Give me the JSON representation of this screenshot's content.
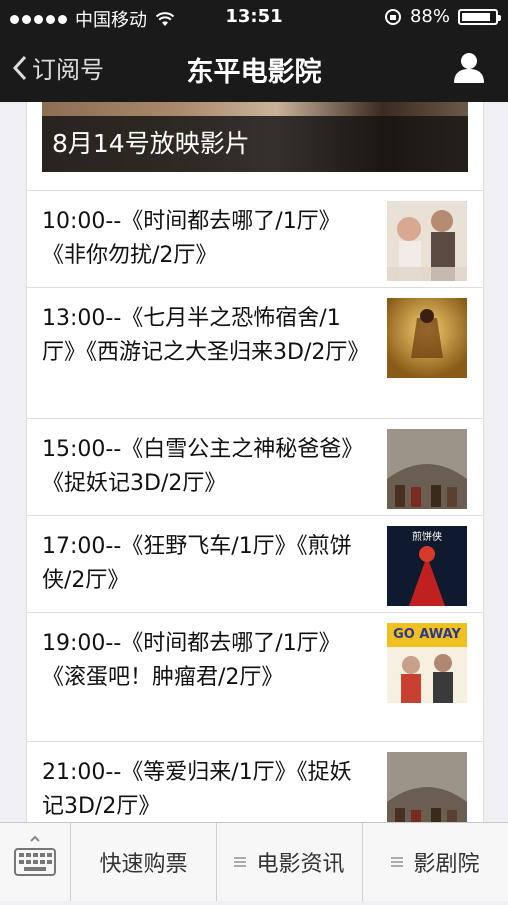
{
  "status": {
    "carrier": "中国移动",
    "time": "13:51",
    "battery": "88%",
    "battery_level": 0.88
  },
  "nav": {
    "back_label": "订阅号",
    "title": "东平电影院"
  },
  "banner": {
    "caption": "8月14号放映影片"
  },
  "schedule": [
    {
      "text": "10:00--《时间都去哪了/1厅》《非你勿扰/2厅》"
    },
    {
      "text": "13:00--《七月半之恐怖宿舍/1厅》《西游记之大圣归来3D/2厅》"
    },
    {
      "text": "15:00--《白雪公主之神秘爸爸》《捉妖记3D/2厅》"
    },
    {
      "text": "17:00--《狂野飞车/1厅》《煎饼侠/2厅》"
    },
    {
      "text": "19:00--《时间都去哪了/1厅》《滚蛋吧！肿瘤君/2厅》"
    },
    {
      "text": "21:00--《等爱归来/1厅》《捉妖记3D/2厅》"
    }
  ],
  "poster_text": {
    "jianbing": "煎饼侠",
    "goaway": "GO AWAY"
  },
  "toolbar": {
    "tab1": "快速购票",
    "tab2": "电影资讯",
    "tab3": "影剧院"
  }
}
